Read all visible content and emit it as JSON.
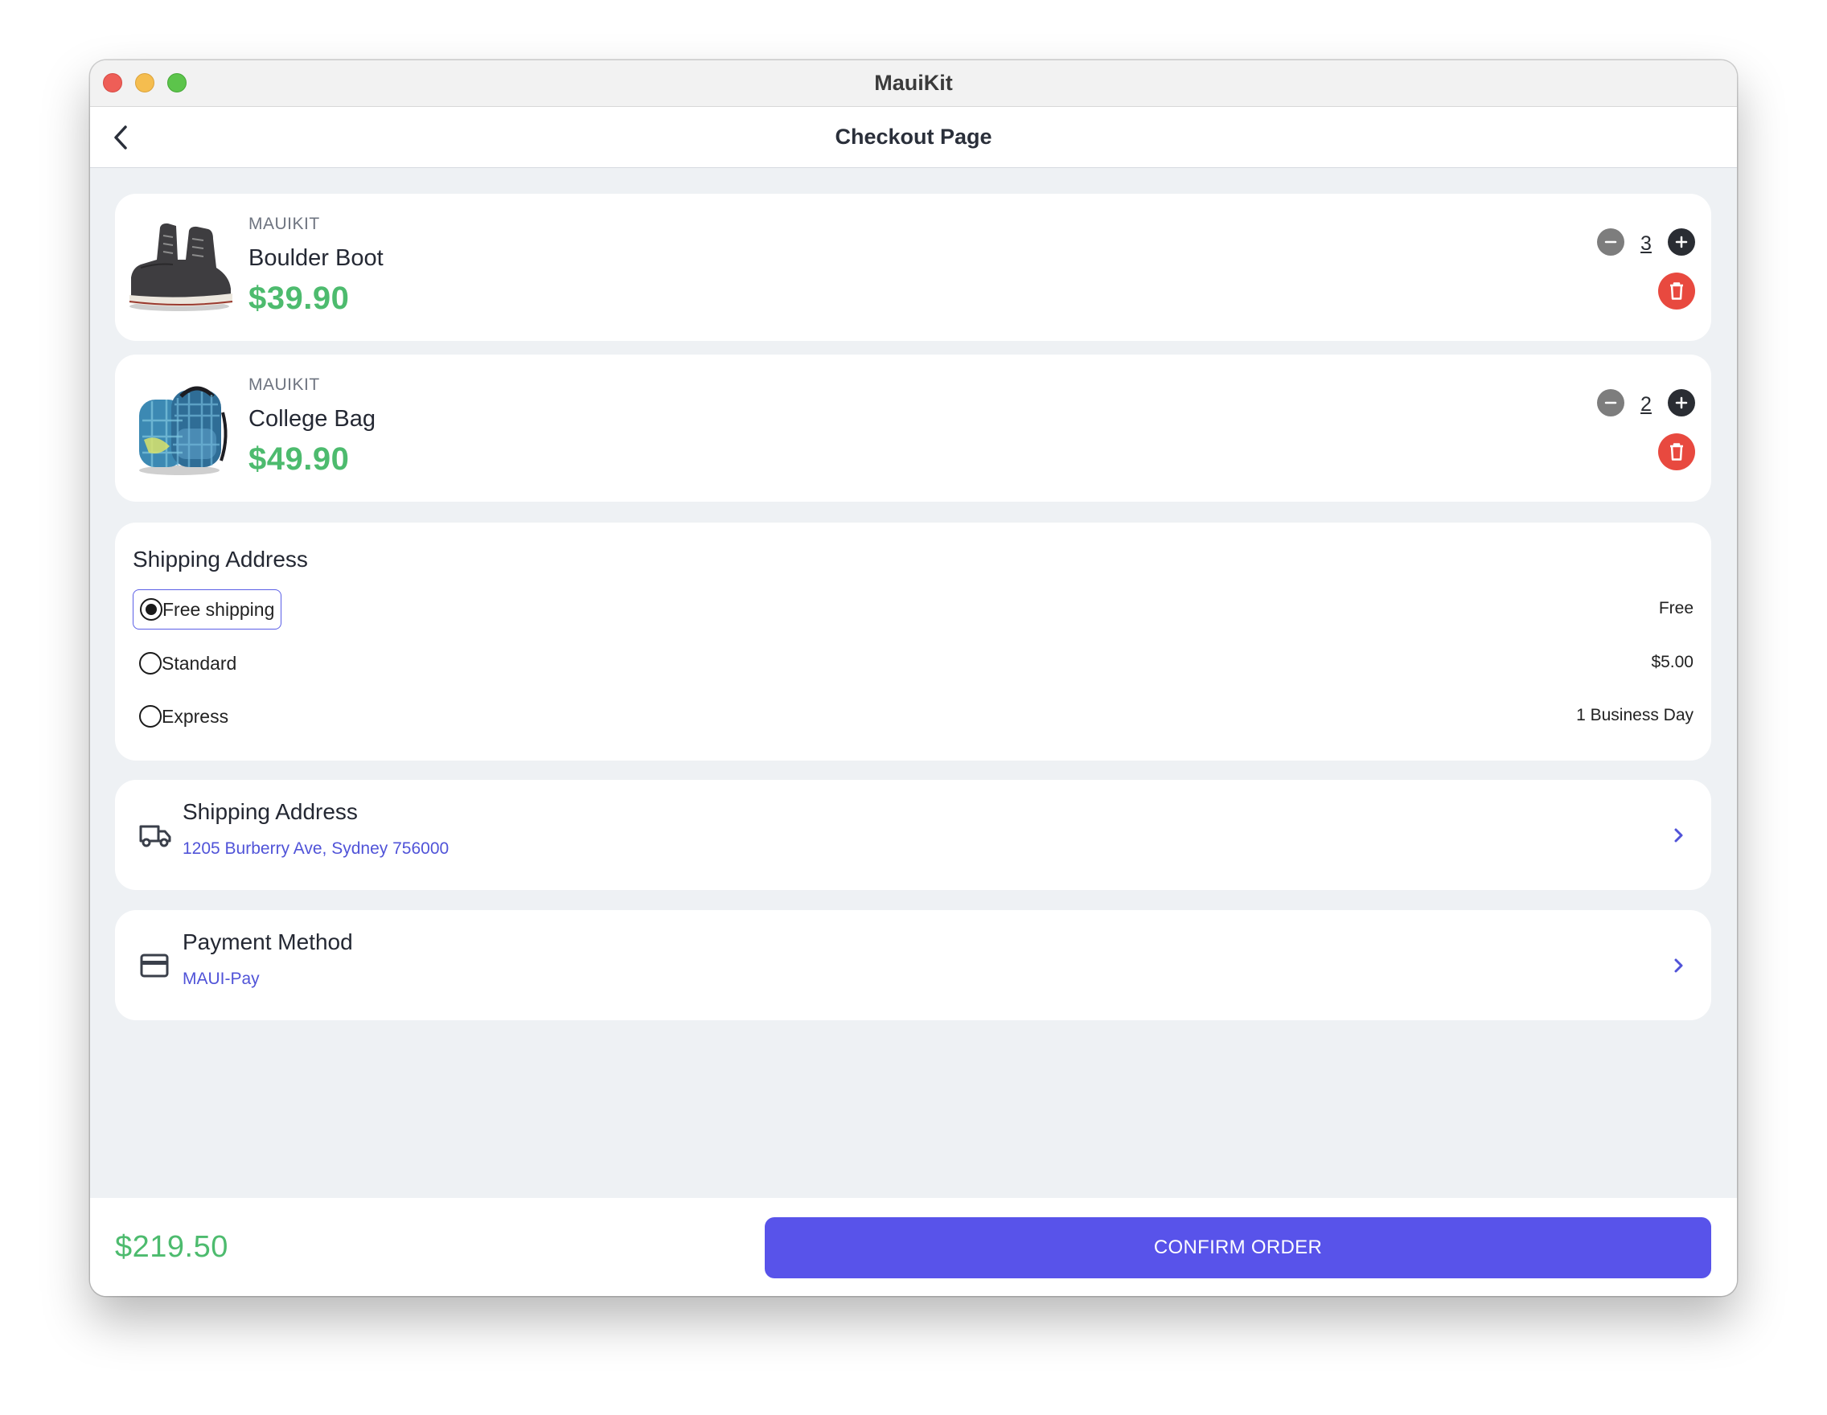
{
  "window": {
    "title": "MauiKit"
  },
  "navbar": {
    "title": "Checkout Page",
    "back_icon": "chevron-left-icon"
  },
  "products": [
    {
      "brand": "MAUIKIT",
      "name": "Boulder Boot",
      "price": "$39.90",
      "quantity": "3",
      "image": "boot-image"
    },
    {
      "brand": "MAUIKIT",
      "name": "College Bag",
      "price": "$49.90",
      "quantity": "2",
      "image": "backpack-image"
    }
  ],
  "shipping_options": {
    "title": "Shipping Address",
    "options": [
      {
        "label": "Free shipping",
        "detail": "Free",
        "selected": true
      },
      {
        "label": "Standard",
        "detail": "$5.00",
        "selected": false
      },
      {
        "label": "Express",
        "detail": "1 Business Day",
        "selected": false
      }
    ]
  },
  "address": {
    "title": "Shipping Address",
    "value": "1205 Burberry Ave, Sydney 756000",
    "icon": "truck-icon"
  },
  "payment": {
    "title": "Payment Method",
    "value": "MAUI-Pay",
    "icon": "credit-card-icon"
  },
  "footer": {
    "total": "$219.50",
    "confirm_label": "CONFIRM ORDER"
  },
  "colors": {
    "accent": "#5853EA",
    "price": "#4DBB6E",
    "delete": "#E8493F",
    "link": "#5053D8"
  }
}
